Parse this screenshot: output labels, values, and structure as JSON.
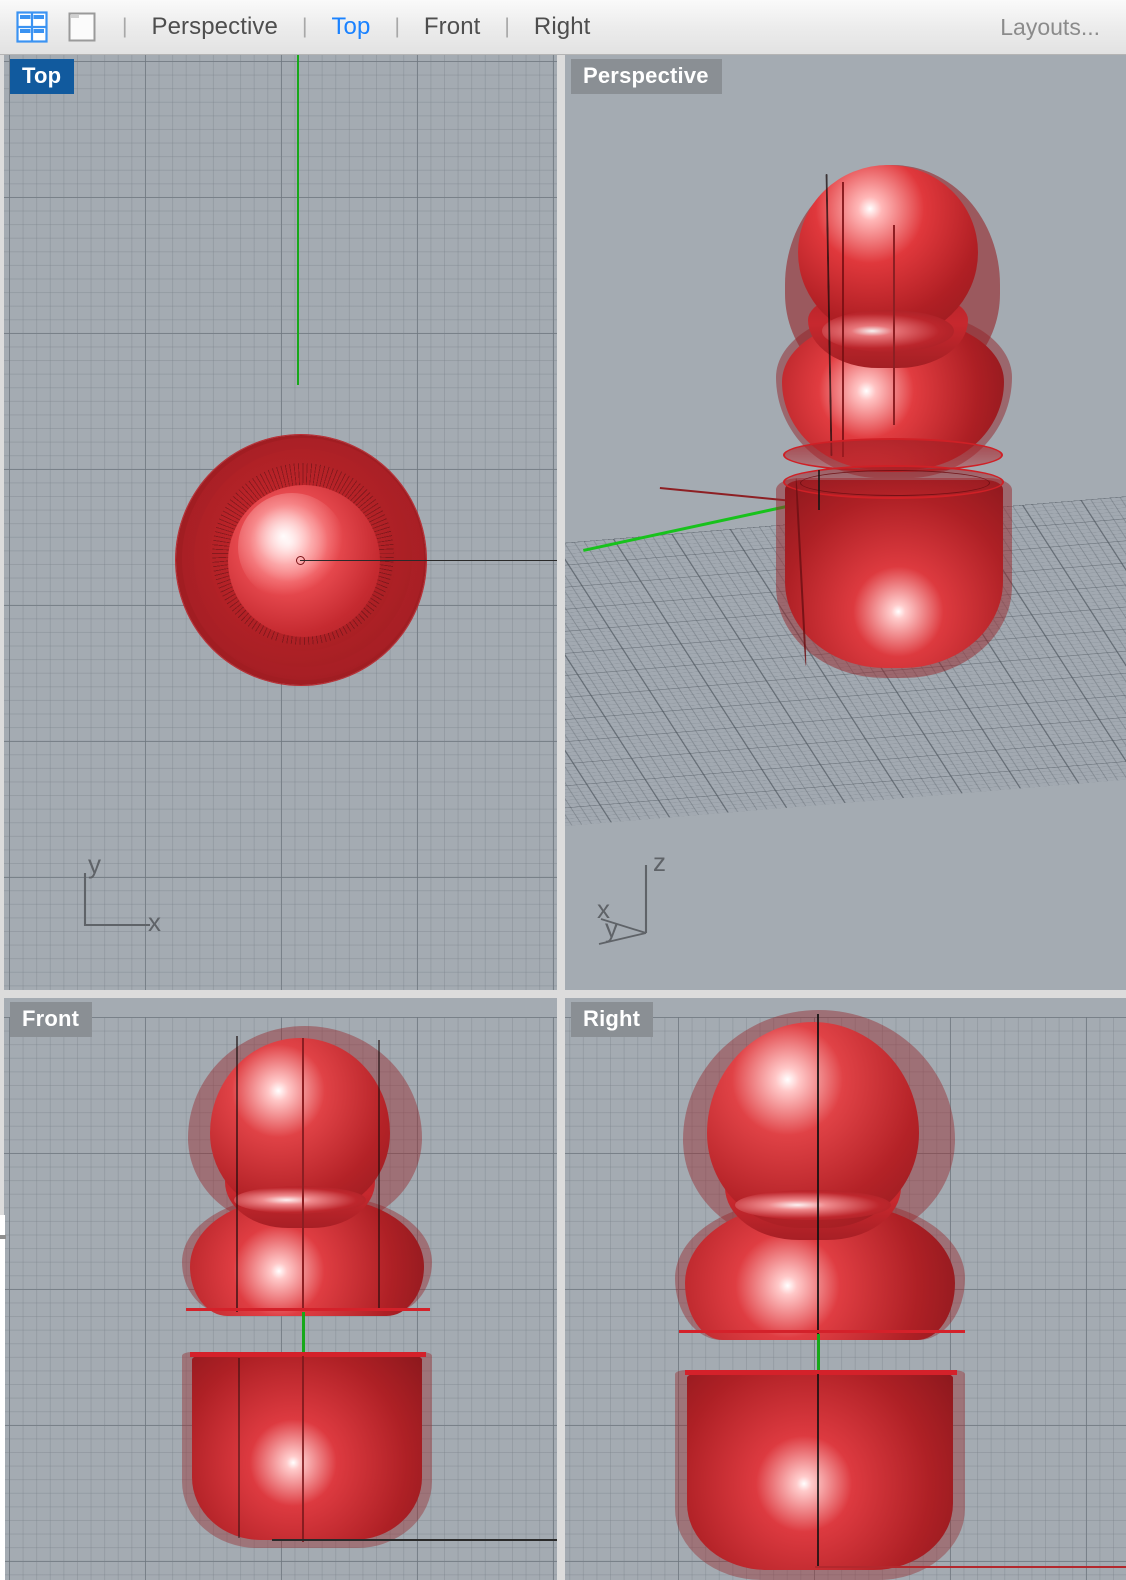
{
  "toolbar": {
    "icons": [
      {
        "name": "four-viewport-layout-icon",
        "label": "4-Pane",
        "active": true
      },
      {
        "name": "single-viewport-layout-icon",
        "label": "1-Pane",
        "active": false
      }
    ],
    "separator": "|",
    "items": [
      {
        "label": "Perspective",
        "active": false
      },
      {
        "label": "Top",
        "active": true
      },
      {
        "label": "Front",
        "active": false
      },
      {
        "label": "Right",
        "active": false
      }
    ],
    "layouts_label": "Layouts...",
    "active_color": "#1a82ff",
    "text_color": "#4e4e4e"
  },
  "viewports": {
    "top": {
      "title": "Top",
      "active": true,
      "title_bg": "#115a9e",
      "axis_labels": {
        "horizontal": "x",
        "vertical": "y"
      },
      "grid": "on"
    },
    "perspective": {
      "title": "Perspective",
      "active": false,
      "title_bg": "#8a8f94",
      "axis_labels": {
        "up": "z",
        "left": "x",
        "down": "y"
      },
      "grid": "on"
    },
    "front": {
      "title": "Front",
      "active": false,
      "title_bg": "#8a8f94",
      "grid": "on"
    },
    "right": {
      "title": "Right",
      "active": false,
      "title_bg": "#8a8f94",
      "grid": "on"
    }
  },
  "model": {
    "description": "Red translucent pawn / matryoshka solid split into an upper bulb and a lower cup",
    "surface_color": "#c2262c",
    "highlight_color": "#ffffff",
    "edge_color": "#d4212a"
  },
  "axes": {
    "x_color": "#b3282d",
    "y_color": "#17a81a",
    "z_color": "#2a2a2a"
  },
  "background": {
    "viewport_bg": "#a4abb2",
    "toolbar_bg": "#ececec",
    "frame_bg": "#dcdcdc"
  }
}
